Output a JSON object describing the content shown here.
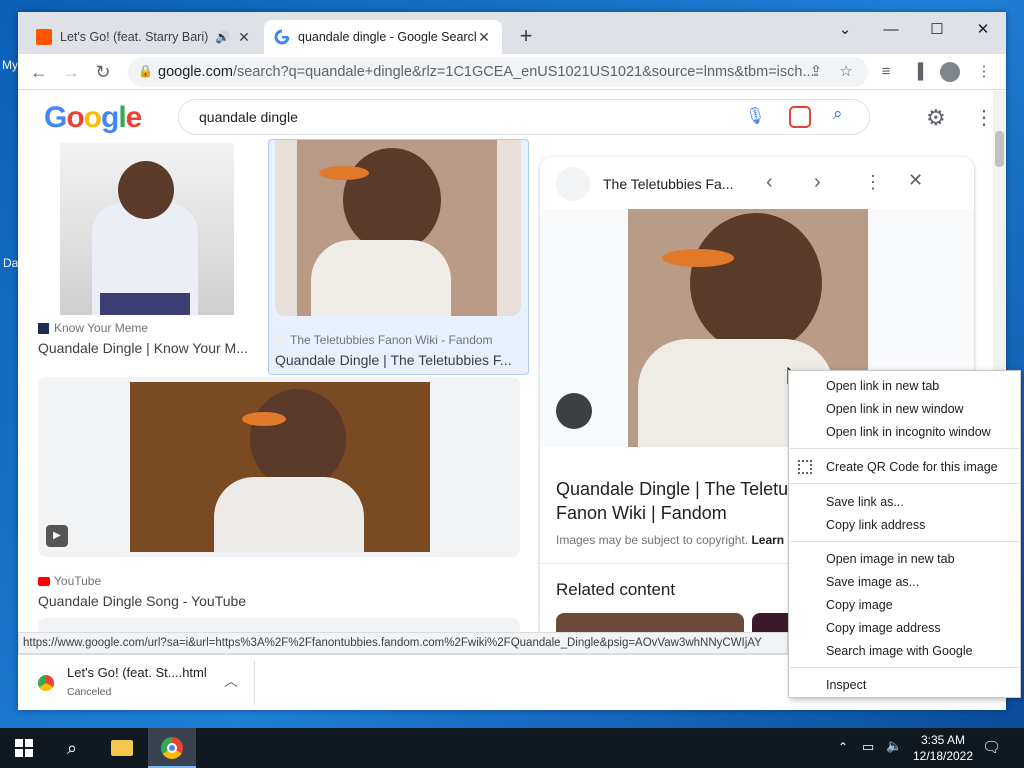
{
  "window": {
    "tabs": [
      {
        "title": "Let's Go! (feat. Starry Bari) pr",
        "favicon": "soundcloud-icon",
        "muted_icon": "speaker-icon"
      },
      {
        "title": "quandale dingle - Google Search",
        "favicon": "google-icon"
      }
    ],
    "controls": {
      "minimize": "—",
      "maximize": "☐",
      "close": "✕",
      "dropdown": "⌄"
    }
  },
  "toolbar": {
    "url_host": "google.com",
    "url_rest": "/search?q=quandale+dingle&rlz=1C1GCEA_enUS1021US1021&source=lnms&tbm=isch..."
  },
  "google": {
    "logo": "Google",
    "query": "quandale dingle"
  },
  "results": [
    {
      "source": "Know Your Meme",
      "title": "Quandale Dingle | Know Your M..."
    },
    {
      "source": "The Teletubbies Fanon Wiki - Fandom",
      "title": "Quandale Dingle | The Teletubbies F..."
    },
    {
      "source": "YouTube",
      "title": "Quandale Dingle Song - YouTube"
    }
  ],
  "panel": {
    "site": "The Teletubbies Fa...",
    "title_line1": "Quandale Dingle | The Teletub",
    "title_line2": "Fanon Wiki | Fandom",
    "copyright": "Images may be subject to copyright.",
    "learn": "Learn",
    "related": "Related content"
  },
  "statusbar": {
    "url": "https://www.google.com/url?sa=i&url=https%3A%2F%2Ffanontubbies.fandom.com%2Fwiki%2FQuandale_Dingle&psig=AOvVaw3whNNyCWIjAY"
  },
  "download": {
    "filename": "Let's Go! (feat. St....html",
    "status": "Canceled"
  },
  "context_menu": {
    "items": [
      "Open link in new tab",
      "Open link in new window",
      "Open link in incognito window",
      "Create QR Code for this image",
      "Save link as...",
      "Copy link address",
      "Open image in new tab",
      "Save image as...",
      "Copy image",
      "Copy image address",
      "Search image with Google",
      "Inspect"
    ]
  },
  "desktop": {
    "label1": "My",
    "label2": "Da"
  },
  "taskbar": {
    "time": "3:35 AM",
    "date": "12/18/2022"
  },
  "colors": {
    "accent": "#1a73e8",
    "tabstrip": "#dee1e6",
    "taskbar": "#101820"
  }
}
